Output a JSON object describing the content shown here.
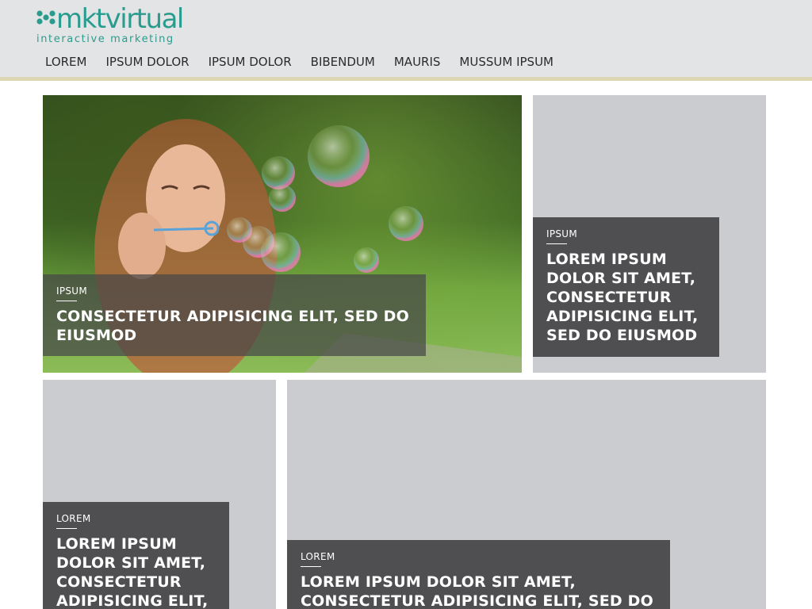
{
  "brand": {
    "name": "mktvirtual",
    "tagline": "interactive marketing",
    "color": "#2a9c8e"
  },
  "nav": {
    "items": [
      "LOREM",
      "IPSUM DOLOR",
      "IPSUM DOLOR",
      "BIBENDUM",
      "MAURIS",
      "MUSSUM IPSUM"
    ]
  },
  "tiles": [
    {
      "category": "IPSUM",
      "title": "CONSECTETUR ADIPISICING ELIT, SED DO EIUSMOD"
    },
    {
      "category": "IPSUM",
      "title": "LOREM IPSUM DOLOR SIT AMET, CONSECTETUR ADIPISICING ELIT, SED DO EIUSMOD"
    },
    {
      "category": "LOREM",
      "title": "LOREM IPSUM DOLOR SIT AMET, CONSECTETUR ADIPISICING ELIT,"
    },
    {
      "category": "LOREM",
      "title": "LOREM IPSUM DOLOR SIT AMET, CONSECTETUR ADIPISICING ELIT, SED DO"
    }
  ],
  "colors": {
    "header_bg": "#e3e4e6",
    "header_border": "#ddd6b5",
    "tile_bg": "#cbccd0",
    "caption_bg": "#444446"
  }
}
